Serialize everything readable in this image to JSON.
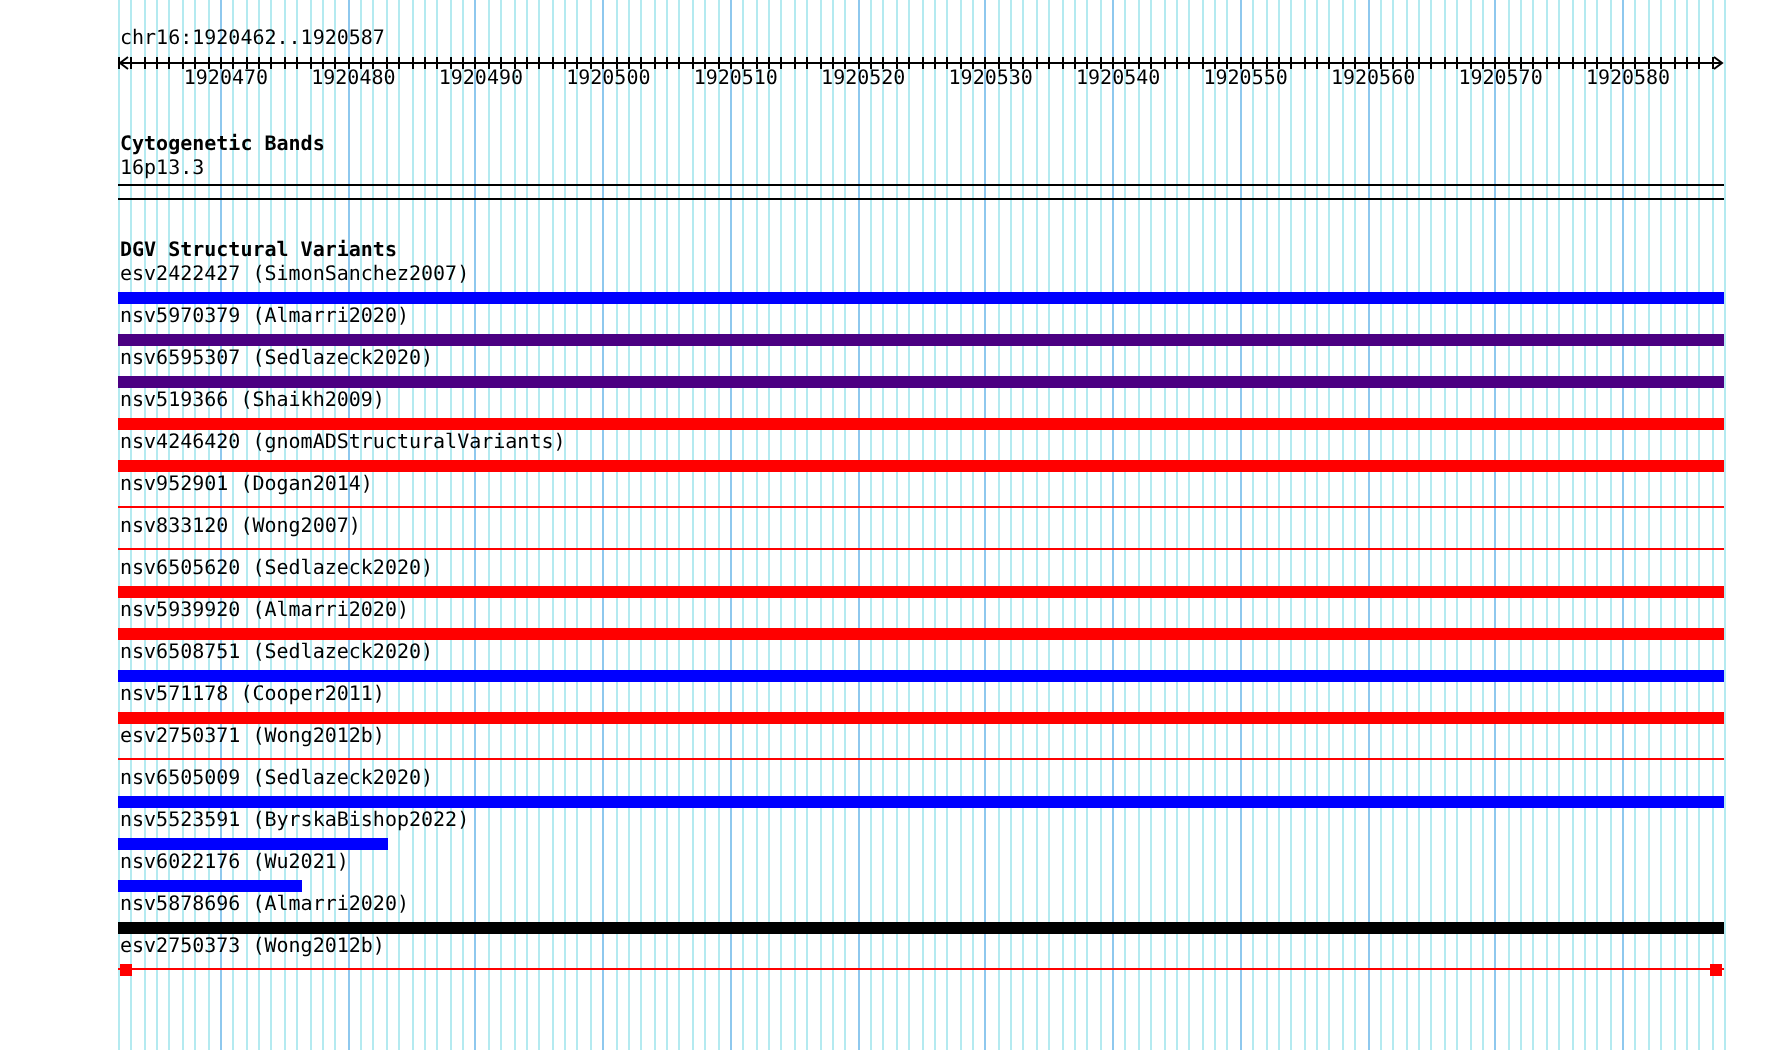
{
  "position": "chr16:1920462..1920587",
  "ruler": {
    "labels": [
      "1920470",
      "1920480",
      "1920490",
      "1920500",
      "1920510",
      "1920520",
      "1920530",
      "1920540",
      "1920550",
      "1920560",
      "1920570",
      "1920580"
    ]
  },
  "cytogenetic_bands": {
    "title": "Cytogenetic Bands",
    "bands": [
      "16p13.3"
    ]
  },
  "dgv": {
    "title": "DGV Structural Variants",
    "variants": [
      {
        "label": "esv2422427 (SimonSanchez2007)",
        "kind": "bar",
        "color": "#0000ff",
        "level": 1
      },
      {
        "label": "nsv5970379 (Almarri2020)",
        "kind": "bar",
        "color": "#4b0082",
        "level": 1
      },
      {
        "label": "nsv6595307 (Sedlazeck2020)",
        "kind": "bar",
        "color": "#4b0082",
        "level": 1
      },
      {
        "label": "nsv519366 (Shaikh2009)",
        "kind": "bar",
        "color": "#ff0000",
        "level": 1
      },
      {
        "label": "nsv4246420 (gnomADStructuralVariants)",
        "kind": "bar",
        "color": "#ff0000",
        "level": 1
      },
      {
        "label": "nsv952901 (Dogan2014)",
        "kind": "line",
        "color": "#ff0000",
        "level": 1
      },
      {
        "label": "nsv833120 (Wong2007)",
        "kind": "line",
        "color": "#ff0000",
        "level": 1
      },
      {
        "label": "nsv6505620 (Sedlazeck2020)",
        "kind": "bar",
        "color": "#ff0000",
        "level": 1
      },
      {
        "label": "nsv5939920 (Almarri2020)",
        "kind": "bar",
        "color": "#ff0000",
        "level": 1
      },
      {
        "label": "nsv6508751 (Sedlazeck2020)",
        "kind": "bar",
        "color": "#0000ff",
        "level": 1
      },
      {
        "label": "nsv571178 (Cooper2011)",
        "kind": "bar",
        "color": "#ff0000",
        "level": 1
      },
      {
        "label": "esv2750371 (Wong2012b)",
        "kind": "line",
        "color": "#ff0000",
        "level": 1
      },
      {
        "label": "nsv6505009 (Sedlazeck2020)",
        "kind": "bar",
        "color": "#0000ff",
        "level": 1
      },
      {
        "label": "nsv5523591 (ByrskaBishop2022)",
        "kind": "bar",
        "color": "#0000ff",
        "level": 0.168
      },
      {
        "label": "nsv6022176 (Wu2021)",
        "kind": "bar",
        "color": "#0000ff",
        "level": 0.114
      },
      {
        "label": "nsv5878696 (Almarri2020)",
        "kind": "bar",
        "color": "#000000",
        "level": 1
      },
      {
        "label": "esv2750373 (Wong2012b)",
        "kind": "capped",
        "color": "#ff0000",
        "level": 1
      }
    ]
  }
}
